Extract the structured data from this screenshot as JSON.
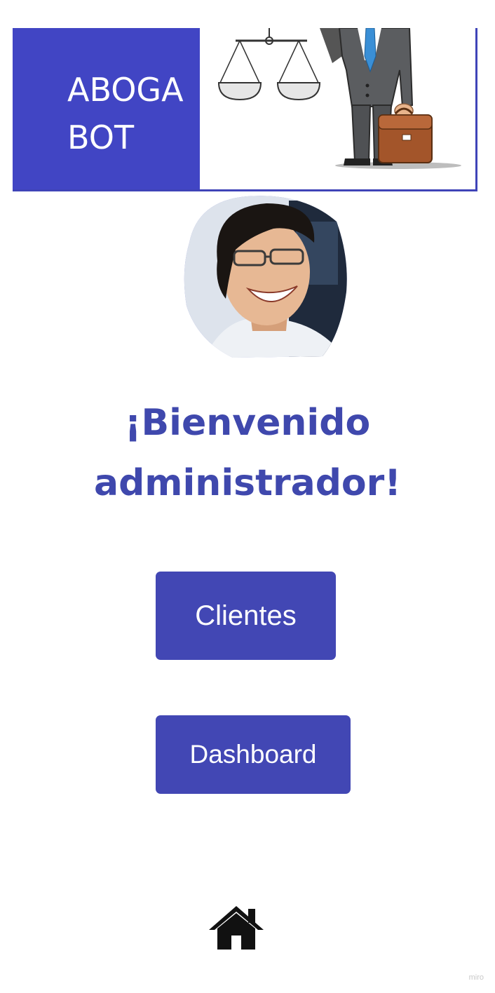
{
  "banner": {
    "line1": "ABOGA",
    "line2": "BOT",
    "logo_icon": "lawyer-with-scales-illustration"
  },
  "avatar": {
    "icon": "user-avatar-photo"
  },
  "welcome": {
    "line1": "¡Bienvenido",
    "line2": "administrador!"
  },
  "buttons": {
    "clientes": "Clientes",
    "dashboard": "Dashboard"
  },
  "nav": {
    "home_icon": "home-icon"
  },
  "watermark": "miro",
  "colors": {
    "brand": "#4145c4",
    "heading": "#3f48ad",
    "button": "#4247b4",
    "text_on_brand": "#ffffff"
  }
}
